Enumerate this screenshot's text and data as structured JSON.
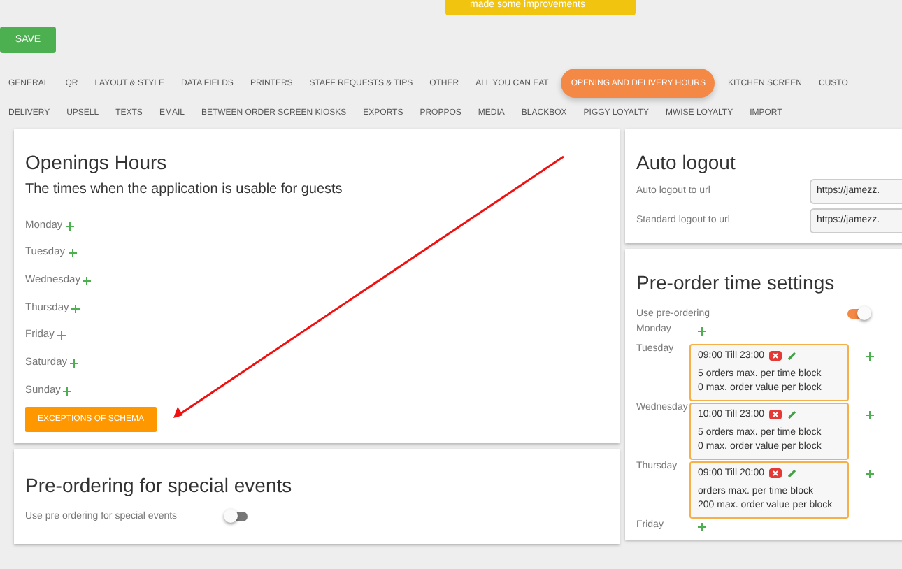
{
  "toast": {
    "text": "made some improvements"
  },
  "save_button": "SAVE",
  "tabs": [
    [
      {
        "label": "GENERAL",
        "selected": false
      },
      {
        "label": "QR",
        "selected": false
      },
      {
        "label": "LAYOUT & STYLE",
        "selected": false
      },
      {
        "label": "DATA FIELDS",
        "selected": false
      },
      {
        "label": "PRINTERS",
        "selected": false
      },
      {
        "label": "STAFF REQUESTS & TIPS",
        "selected": false
      },
      {
        "label": "OTHER",
        "selected": false
      },
      {
        "label": "ALL YOU CAN EAT",
        "selected": false
      },
      {
        "label": "OPENING AND DELIVERY HOURS",
        "selected": true
      },
      {
        "label": "KITCHEN SCREEN",
        "selected": false
      },
      {
        "label": "CUSTO",
        "selected": false
      }
    ],
    [
      {
        "label": "DELIVERY",
        "selected": false
      },
      {
        "label": "UPSELL",
        "selected": false
      },
      {
        "label": "TEXTS",
        "selected": false
      },
      {
        "label": "EMAIL",
        "selected": false
      },
      {
        "label": "BETWEEN ORDER SCREEN KIOSKS",
        "selected": false
      },
      {
        "label": "EXPORTS",
        "selected": false
      },
      {
        "label": "PROPPOS",
        "selected": false
      },
      {
        "label": "MEDIA",
        "selected": false
      },
      {
        "label": "BLACKBOX",
        "selected": false
      },
      {
        "label": "PIGGY LOYALTY",
        "selected": false
      },
      {
        "label": "MWISE LOYALTY",
        "selected": false
      },
      {
        "label": "IMPORT",
        "selected": false
      }
    ]
  ],
  "opening_hours": {
    "title": "Openings Hours",
    "subtitle": "The times when the application is usable for guests",
    "days": [
      "Monday",
      "Tuesday",
      "Wednesday",
      "Thursday",
      "Friday",
      "Saturday",
      "Sunday"
    ],
    "button": "EXCEPTIONS OF SCHEMA"
  },
  "special_events": {
    "title": "Pre-ordering for special events",
    "label": "Use pre ordering for special events",
    "on": false
  },
  "auto_logout": {
    "title": "Auto logout",
    "fields": [
      {
        "label": "Auto logout to url",
        "value": "https://jamezz."
      },
      {
        "label": "Standard logout to url",
        "value": "https://jamezz."
      }
    ]
  },
  "pre_order": {
    "title": "Pre-order time settings",
    "label": "Use pre-ordering",
    "on": true,
    "days": [
      {
        "day": "Monday"
      },
      {
        "day": "Tuesday",
        "slots": [
          {
            "time": "09:00 Till 23:00",
            "orders": "5 orders max. per time block",
            "value": "0 max. order value per block"
          }
        ]
      },
      {
        "day": "Wednesday",
        "slots": [
          {
            "time": "10:00 Till 23:00",
            "orders": "5 orders max. per time block",
            "value": "0 max. order value per block"
          }
        ]
      },
      {
        "day": "Thursday",
        "slots": [
          {
            "time": "09:00 Till 20:00",
            "orders": "orders max. per time block",
            "value": "200 max. order value per block"
          }
        ]
      },
      {
        "day": "Friday"
      }
    ]
  }
}
